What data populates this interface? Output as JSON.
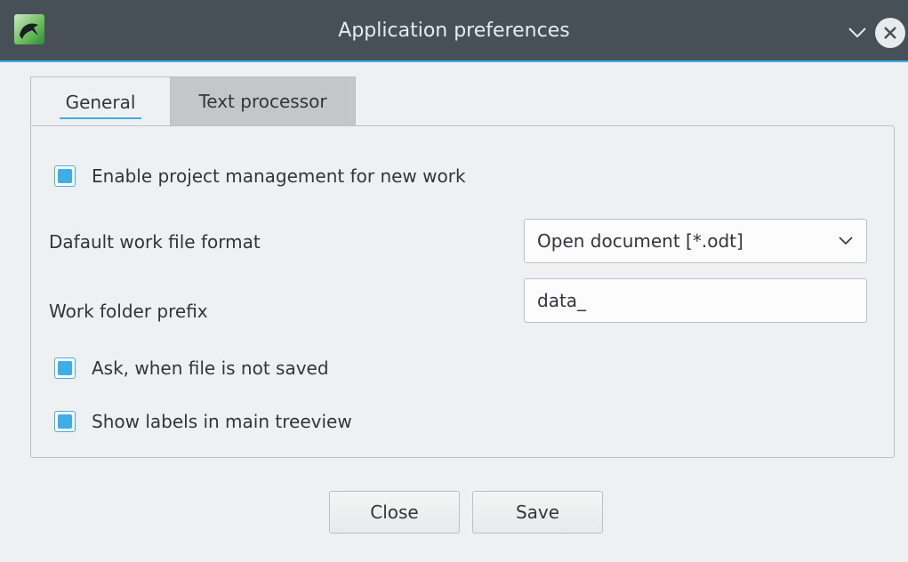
{
  "window": {
    "title": "Application preferences",
    "icons": {
      "app": "app-logo-icon",
      "minimize": "chevron-down-icon",
      "close": "close-circle-icon"
    }
  },
  "tabs": [
    {
      "label": "General",
      "active": true
    },
    {
      "label": "Text processor",
      "active": false
    }
  ],
  "general": {
    "enable_project_management": {
      "label": "Enable project management for new work",
      "checked": true
    },
    "default_format": {
      "label": "Dafault work file format",
      "selected": "Open document [*.odt]"
    },
    "work_folder_prefix": {
      "label": "Work folder prefix",
      "value": "data_"
    },
    "ask_unsaved": {
      "label": "Ask, when file is not saved",
      "checked": true
    },
    "show_labels": {
      "label": "Show labels in main treeview",
      "checked": true
    }
  },
  "buttons": {
    "close": "Close",
    "save": "Save"
  },
  "colors": {
    "accent": "#3daee9",
    "titlebar": "#475057",
    "background": "#eff0f1"
  }
}
